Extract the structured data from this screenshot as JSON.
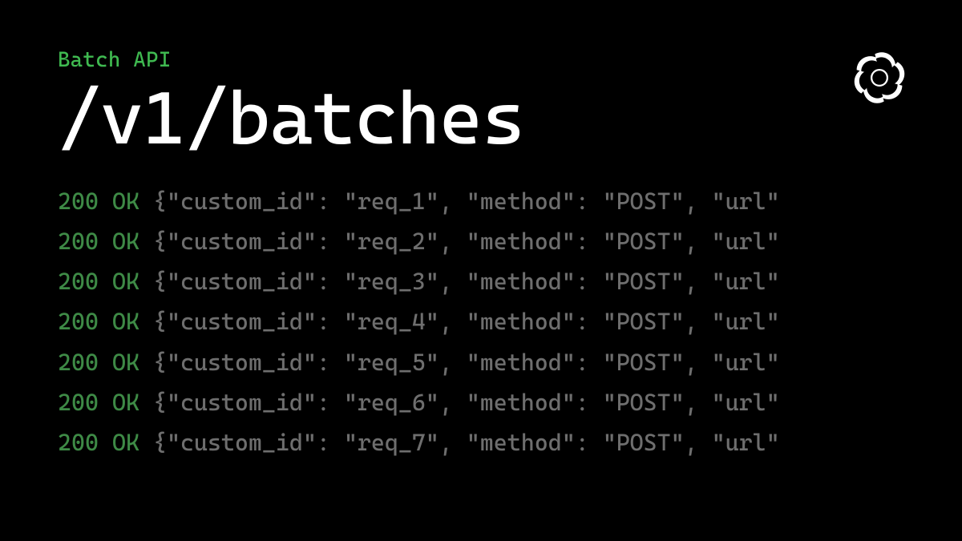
{
  "colors": {
    "accent_green": "#3fb950",
    "status_green": "#3e8a46",
    "payload_gray": "#6e6e6e",
    "title_white": "#ffffff",
    "bg_black": "#000000"
  },
  "header": {
    "subtitle": "Batch API",
    "title": "/v1/batches"
  },
  "logo": {
    "name": "openai-logo"
  },
  "log_lines": [
    {
      "status": "200 OK",
      "payload": "{\"custom_id\": \"req_1\", \"method\": \"POST\", \"url\""
    },
    {
      "status": "200 OK",
      "payload": "{\"custom_id\": \"req_2\", \"method\": \"POST\", \"url\""
    },
    {
      "status": "200 OK",
      "payload": "{\"custom_id\": \"req_3\", \"method\": \"POST\", \"url\""
    },
    {
      "status": "200 OK",
      "payload": "{\"custom_id\": \"req_4\", \"method\": \"POST\", \"url\""
    },
    {
      "status": "200 OK",
      "payload": "{\"custom_id\": \"req_5\", \"method\": \"POST\", \"url\""
    },
    {
      "status": "200 OK",
      "payload": "{\"custom_id\": \"req_6\", \"method\": \"POST\", \"url\""
    },
    {
      "status": "200 OK",
      "payload": "{\"custom_id\": \"req_7\", \"method\": \"POST\", \"url\""
    }
  ]
}
